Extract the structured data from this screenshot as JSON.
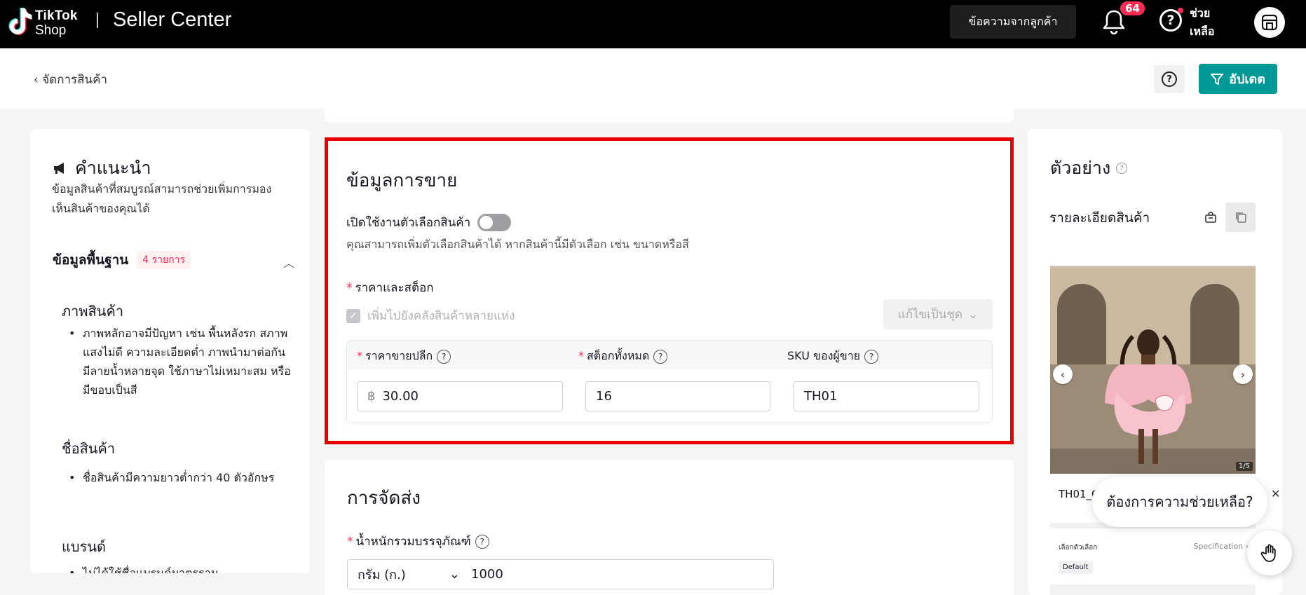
{
  "header": {
    "brand_top": "TikTok",
    "brand_bottom": "Shop",
    "title": "Seller Center",
    "customer_messages": "ข้อความจากลูกค้า",
    "notification_count": "64",
    "help_label": "ช่วย เหลือ",
    "accent_color": "#fe2c55"
  },
  "subheader": {
    "back_label": "‹ จัดการสินค้า",
    "help_icon": "?",
    "update_label": "อัปเดต",
    "update_color": "#009995"
  },
  "tips": {
    "title": "คำแนะนำ",
    "subtitle": "ข้อมูลสินค้าที่สมบูรณ์สามารถช่วยเพิ่มการมองเห็นสินค้าของคุณได้",
    "basic_title": "ข้อมูลพื้นฐาน",
    "basic_badge": "4 รายการ",
    "sections": [
      {
        "title": "ภาพสินค้า",
        "bullet": "ภาพหลักอาจมีปัญหา เช่น พื้นหลังรก สภาพแสงไม่ดี ความละเอียดต่ำ ภาพนำมาต่อกัน มีลายน้ำหลายจุด ใช้ภาษาไม่เหมาะสม หรือมีขอบเป็นสี"
      },
      {
        "title": "ชื่อสินค้า",
        "bullet": "ชื่อสินค้ามีความยาวต่ำกว่า 40 ตัวอักษร"
      },
      {
        "title": "แบรนด์",
        "bullet": "ไม่ได้ใช้ชื่อแบรนด์มาตรฐาน"
      }
    ]
  },
  "sales": {
    "title": "ข้อมูลการขาย",
    "variant_toggle_label": "เปิดใช้งานตัวเลือกสินค้า",
    "variant_desc": "คุณสามารถเพิ่มตัวเลือกสินค้าได้ หากสินค้านี้มีตัวเลือก เช่น ขนาดหรือสี",
    "price_stock_label": "ราคาและสต็อก",
    "multi_warehouse_label": "เพิ่มไปยังคลังสินค้าหลายแห่ง",
    "batch_edit_label": "แก้ไขเป็นชุด",
    "columns": {
      "price": "ราคาขายปลีก",
      "stock": "สต็อกทั้งหมด",
      "sku": "SKU ของผู้ขาย"
    },
    "values": {
      "currency": "฿",
      "price": "30.00",
      "stock": "16",
      "sku": "TH01"
    },
    "highlight_color": "#e80000"
  },
  "shipping": {
    "title": "การจัดส่ง",
    "weight_label": "น้ำหนักรวมบรรจุภัณฑ์",
    "weight_unit": "กรัม (ก.)",
    "weight_value": "1000"
  },
  "preview": {
    "title": "ตัวอย่าง",
    "detail_title": "รายละเอียดสินค้า",
    "image_counter": "1/5",
    "product_name": "TH01_C",
    "variant_label": "เลือกตัวเลือก",
    "spec_label": "Specification ›",
    "default_option": "Default"
  },
  "floating_help": {
    "label": "ต้องการความช่วยเหลือ?"
  }
}
